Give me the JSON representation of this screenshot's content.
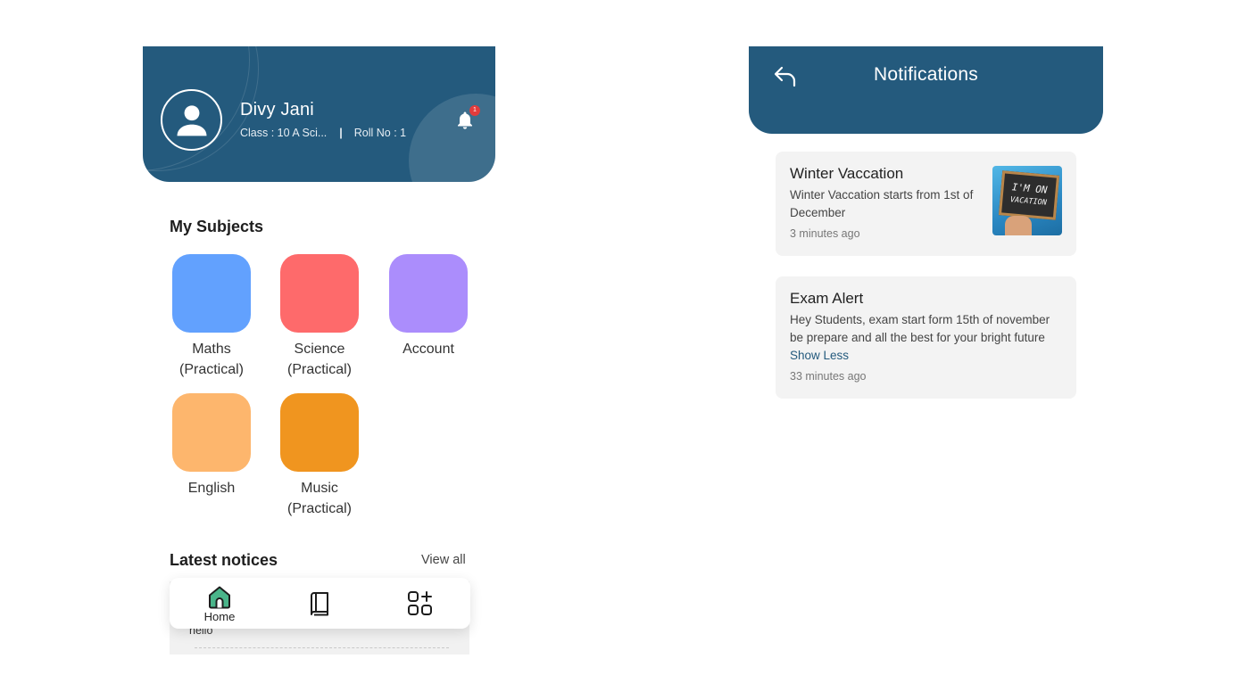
{
  "home": {
    "student": {
      "name": "Divy Jani",
      "class_text": "Class : 10 A Sci...",
      "separator": "|",
      "roll_text": "Roll No : 1",
      "notification_count": "1"
    },
    "subjects_title": "My Subjects",
    "subjects": [
      {
        "label": "Maths\n(Practical)",
        "color": "#62a1fe"
      },
      {
        "label": "Science\n(Practical)",
        "color": "#fe6a6b"
      },
      {
        "label": "Account",
        "color": "#ab8dfc"
      },
      {
        "label": "English",
        "color": "#fdb66d"
      },
      {
        "label": "Music\n(Practical)",
        "color": "#f0951f"
      }
    ],
    "notices_title": "Latest notices",
    "view_all": "View all",
    "notice_preview": "hello",
    "nav": {
      "home_label": "Home",
      "active_color": "#4ab58a"
    },
    "colors": {
      "header": "#245a7d"
    }
  },
  "notifications": {
    "title": "Notifications",
    "items": [
      {
        "title": "Winter Vaccation",
        "body": "Winter Vaccation starts from 1st of December",
        "time": "3 minutes ago",
        "image_text_1": "I'M ON",
        "image_text_2": "VACATION"
      },
      {
        "title": "Exam Alert",
        "body": "Hey Students, exam start form 15th of november be prepare and all the best for your bright future",
        "link": "Show Less",
        "time": "33 minutes ago"
      }
    ]
  }
}
